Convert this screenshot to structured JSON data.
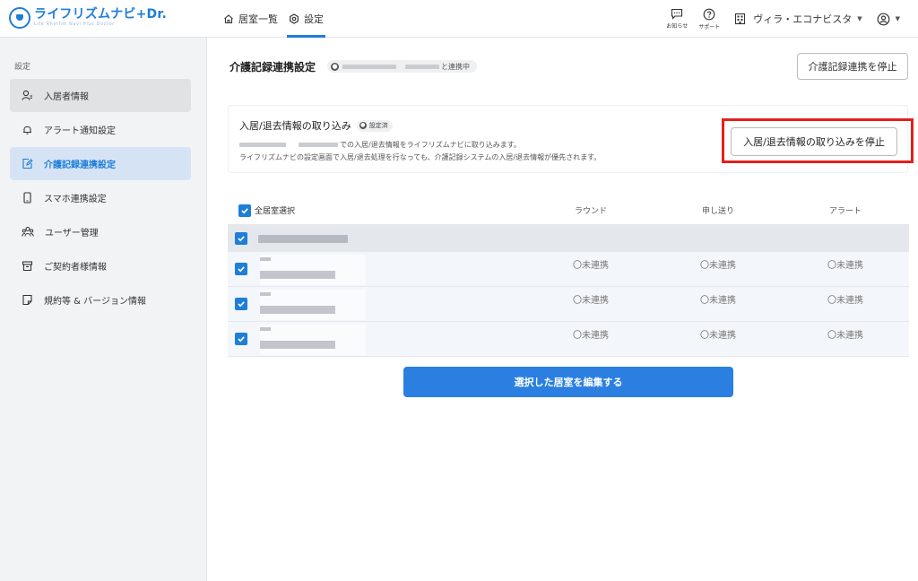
{
  "brand": {
    "name": "ライフリズムナビ+Dr.",
    "subtitle": "Life Rhythm Navi Plus Doctor"
  },
  "nav": {
    "items": [
      {
        "label": "居室一覧",
        "icon": "home-icon"
      },
      {
        "label": "設定",
        "icon": "gear-icon",
        "active": true
      }
    ]
  },
  "header": {
    "notifications_label": "お知らせ",
    "support_label": "サポート",
    "facility_name": "ヴィラ・エコナビスタ"
  },
  "sidebar": {
    "heading": "設定",
    "items": [
      {
        "label": "入居者情報"
      },
      {
        "label": "アラート通知設定"
      },
      {
        "label": "介護記録連携設定"
      },
      {
        "label": "スマホ連携設定"
      },
      {
        "label": "ユーザー管理"
      },
      {
        "label": "ご契約者様情報"
      },
      {
        "label": "規約等 & バージョン情報"
      }
    ]
  },
  "main": {
    "title": "介護記録連携設定",
    "connection_suffix": "と連携中",
    "stop_integration_label": "介護記録連携を停止",
    "import_card": {
      "title": "入居/退去情報の取り込み",
      "status_tag": "設定済",
      "line1_suffix": "での入居/退去情報をライフリズムナビに取り込みます。",
      "line2": "ライフリズムナビの設定画面で入居/退去処理を行なっても、介護記録システムの入居/退去情報が優先されます。",
      "stop_import_label": "入居/退去情報の取り込みを停止"
    },
    "table": {
      "select_all_label": "全居室選択",
      "columns": [
        "ラウンド",
        "申し送り",
        "アラート"
      ],
      "rows": [
        {
          "round": "〇未連携",
          "handover": "〇未連携",
          "alert": "〇未連携"
        },
        {
          "round": "〇未連携",
          "handover": "〇未連携",
          "alert": "〇未連携"
        },
        {
          "round": "〇未連携",
          "handover": "〇未連携",
          "alert": "〇未連携"
        }
      ]
    },
    "edit_button_label": "選択した居室を編集する"
  },
  "colors": {
    "accent": "#1e7ed8",
    "highlight": "#e3201b",
    "sidebar_bg": "#f2f3f5",
    "active_bg": "#d5e3f5"
  }
}
